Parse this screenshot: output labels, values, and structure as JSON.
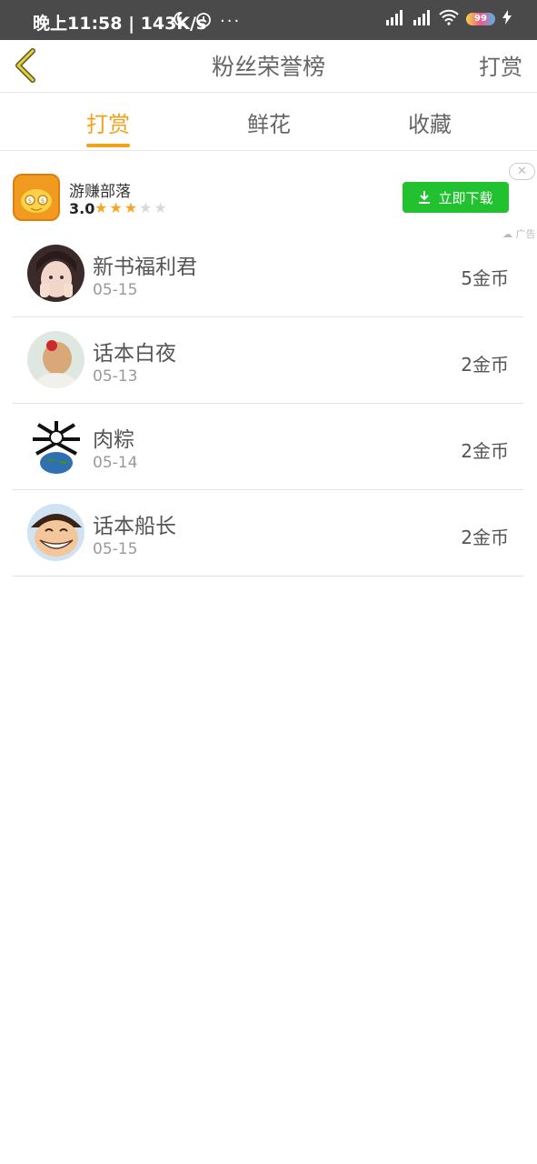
{
  "status": {
    "time": "晚上11:58 | 143K/s",
    "battery": "99"
  },
  "header": {
    "title": "粉丝荣誉榜",
    "action": "打赏"
  },
  "tabs": [
    {
      "label": "打赏",
      "active": true
    },
    {
      "label": "鲜花",
      "active": false
    },
    {
      "label": "收藏",
      "active": false
    }
  ],
  "ad": {
    "app_name": "游赚部落",
    "rating": "3.0",
    "stars": 3,
    "download_label": "立即下载",
    "tag": "广告"
  },
  "rows": [
    {
      "name": "新书福利君",
      "date": "05-15",
      "amount": "5金币"
    },
    {
      "name": "话本白夜",
      "date": "05-13",
      "amount": "2金币"
    },
    {
      "name": "肉粽",
      "date": "05-14",
      "amount": "2金币"
    },
    {
      "name": "话本船长",
      "date": "05-15",
      "amount": "2金币"
    }
  ],
  "colors": {
    "accent": "#f0a21a",
    "download_button": "#22c12f"
  }
}
